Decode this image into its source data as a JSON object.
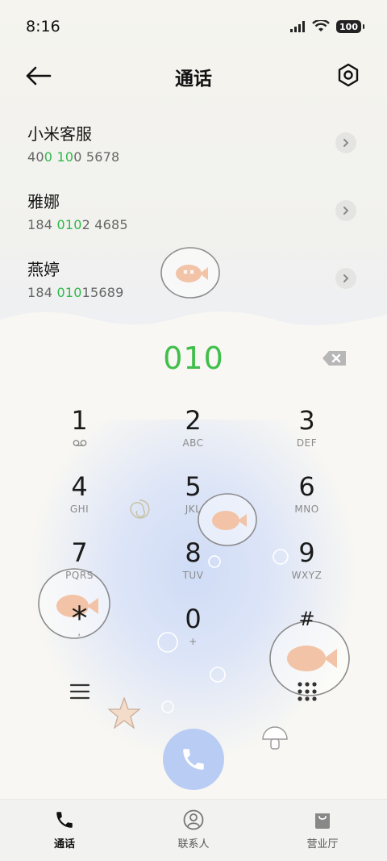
{
  "status_bar": {
    "time": "8:16",
    "battery": "100"
  },
  "header": {
    "title": "通话"
  },
  "contacts": [
    {
      "name": "小米客服",
      "number_parts": [
        "40",
        "0",
        " ",
        "10",
        "0 5678"
      ]
    },
    {
      "name": "雅娜",
      "number_parts": [
        "184 ",
        "010",
        "2 4685",
        "",
        ""
      ]
    },
    {
      "name": "燕婷",
      "number_parts": [
        "184 ",
        "010",
        "15689",
        "",
        ""
      ]
    }
  ],
  "dial": {
    "input": "010"
  },
  "keypad": [
    {
      "digit": "1",
      "sub": ""
    },
    {
      "digit": "2",
      "sub": "ABC"
    },
    {
      "digit": "3",
      "sub": "DEF"
    },
    {
      "digit": "4",
      "sub": "GHI"
    },
    {
      "digit": "5",
      "sub": "JKL"
    },
    {
      "digit": "6",
      "sub": "MNO"
    },
    {
      "digit": "7",
      "sub": "PQRS"
    },
    {
      "digit": "8",
      "sub": "TUV"
    },
    {
      "digit": "9",
      "sub": "WXYZ"
    },
    {
      "digit": "*",
      "sub": ","
    },
    {
      "digit": "0",
      "sub": "+"
    },
    {
      "digit": "#",
      "sub": ""
    }
  ],
  "nav": [
    {
      "label": "通话",
      "icon": "phone-icon",
      "active": true
    },
    {
      "label": "联系人",
      "icon": "person-icon",
      "active": false
    },
    {
      "label": "营业厅",
      "icon": "bag-icon",
      "active": false
    }
  ],
  "colors": {
    "accent_green": "#3fbf4a",
    "call_button": "#b9cdf4"
  }
}
